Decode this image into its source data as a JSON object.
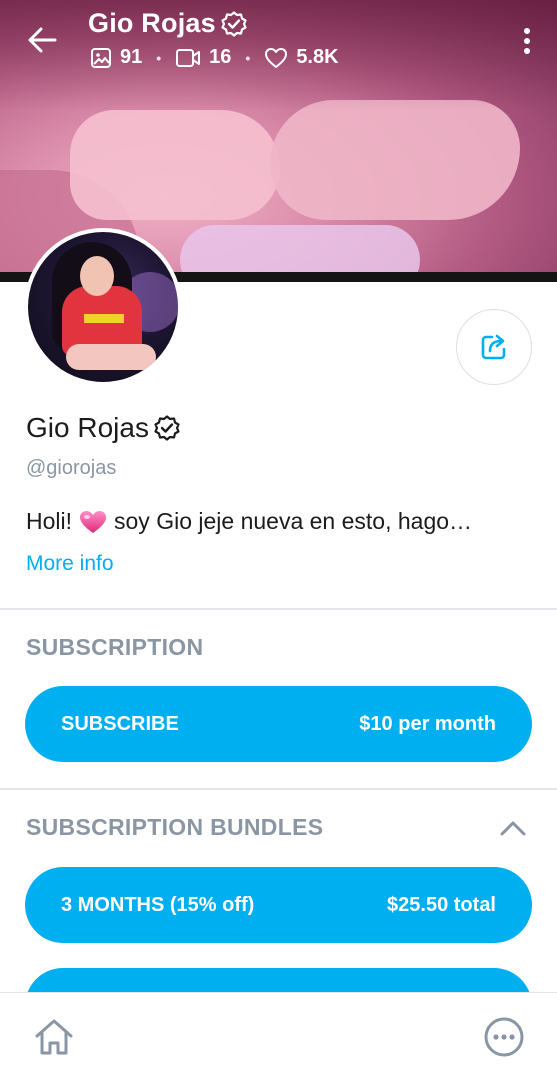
{
  "header": {
    "name": "Gio Rojas",
    "stats": {
      "photos": "91",
      "videos": "16",
      "likes": "5.8K"
    }
  },
  "profile": {
    "name": "Gio Rojas",
    "handle": "@giorojas",
    "bio_start": "Holi!",
    "bio_end": "soy Gio jeje nueva en esto, hago…",
    "more_info": "More info"
  },
  "subscription": {
    "title": "SUBSCRIPTION",
    "button_label": "SUBSCRIBE",
    "button_price": "$10 per month"
  },
  "bundles": {
    "title": "SUBSCRIPTION BUNDLES",
    "items": [
      {
        "label": "3 MONTHS (15% off)",
        "price": "$25.50 total"
      }
    ]
  },
  "colors": {
    "accent": "#00aff0",
    "muted_text": "#8a96a3",
    "divider": "#e4e6ea"
  },
  "icons": [
    "back-arrow-icon",
    "photo-icon",
    "video-icon",
    "heart-icon",
    "verified-icon",
    "kebab-menu-icon",
    "share-icon",
    "chevron-up-icon",
    "home-icon",
    "more-dots-icon"
  ]
}
